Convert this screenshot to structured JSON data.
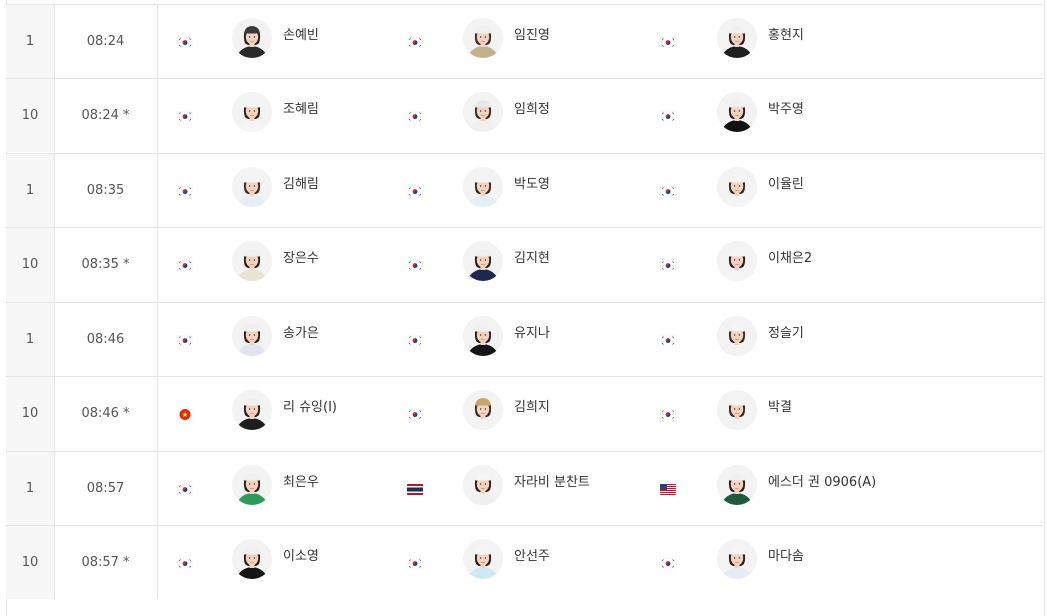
{
  "rows": [
    {
      "tee": "1",
      "time": "08:24",
      "players": [
        {
          "name": "손예빈",
          "flag": "kor",
          "jersey": "#2b2b2b",
          "hair": "#2a1f1a",
          "cap": "#3a3a3a"
        },
        {
          "name": "임진영",
          "flag": "kor",
          "jersey": "#c2b18d",
          "hair": "#3a2a20",
          "cap": "#f0f0f0"
        },
        {
          "name": "홍현지",
          "flag": "kor",
          "jersey": "#1f1f1f",
          "hair": "#2a1f1a",
          "cap": "#f0f0f0"
        }
      ]
    },
    {
      "tee": "10",
      "time": "08:24 *",
      "players": [
        {
          "name": "조혜림",
          "flag": "kor",
          "jersey": "#f5f5f5",
          "hair": "#2a1f1a",
          "cap": "#f5f5f5"
        },
        {
          "name": "임희정",
          "flag": "kor",
          "jersey": "#f0f0f0",
          "hair": "#3a2a20",
          "cap": "#e8e8e8"
        },
        {
          "name": "박주영",
          "flag": "kor",
          "jersey": "#111111",
          "hair": "#2a1f1a",
          "cap": "#f0f0f0"
        }
      ]
    },
    {
      "tee": "1",
      "time": "08:35",
      "players": [
        {
          "name": "김해림",
          "flag": "kor",
          "jersey": "#e8eef6",
          "hair": "#3a2a20",
          "cap": "#f5f5f5"
        },
        {
          "name": "박도영",
          "flag": "kor",
          "jersey": "#e6edf5",
          "hair": "#3a2a20",
          "cap": "#f5f5f5"
        },
        {
          "name": "이율린",
          "flag": "kor",
          "jersey": "#f5f5f5",
          "hair": "#3a2a20",
          "cap": "#f5f5f5"
        }
      ]
    },
    {
      "tee": "10",
      "time": "08:35 *",
      "players": [
        {
          "name": "장은수",
          "flag": "kor",
          "jersey": "#e9e3d3",
          "hair": "#2a1f1a",
          "cap": "#f0f0f0"
        },
        {
          "name": "김지현",
          "flag": "kor",
          "jersey": "#1e2750",
          "hair": "#2a1f1a",
          "cap": "#f0f0f0"
        },
        {
          "name": "이채은2",
          "flag": "kor",
          "jersey": "#f5f5f5",
          "hair": "#2a1f1a",
          "cap": "#f5f5f5"
        }
      ]
    },
    {
      "tee": "1",
      "time": "08:46",
      "players": [
        {
          "name": "송가은",
          "flag": "kor",
          "jersey": "#dfe6ef",
          "hair": "#2a1f1a",
          "cap": "#f0f0f0"
        },
        {
          "name": "유지나",
          "flag": "kor",
          "jersey": "#141414",
          "hair": "#2a1f1a",
          "cap": "#f0f0f0"
        },
        {
          "name": "정슬기",
          "flag": "kor",
          "jersey": "#f3f3f3",
          "hair": "#3a2a20",
          "cap": "#f5f5f5"
        }
      ]
    },
    {
      "tee": "10",
      "time": "08:46 *",
      "players": [
        {
          "name": "리 슈잉(I)",
          "flag": "chn",
          "jersey": "#1d1d1d",
          "hair": "#2a1f1a",
          "cap": "#f0f0f0"
        },
        {
          "name": "김희지",
          "flag": "kor",
          "jersey": "#f3f3f3",
          "hair": "#3a2a20",
          "cap": "#c9a56b"
        },
        {
          "name": "박결",
          "flag": "kor",
          "jersey": "#f2f2f2",
          "hair": "#3a2a20",
          "cap": "#f5f5f5"
        }
      ]
    },
    {
      "tee": "1",
      "time": "08:57",
      "players": [
        {
          "name": "최은우",
          "flag": "kor",
          "jersey": "#2e9a55",
          "hair": "#2a1f1a",
          "cap": "#f0f0f0"
        },
        {
          "name": "자라비 분찬트",
          "flag": "tha",
          "jersey": "#f0f0f0",
          "hair": "#2a1f1a",
          "cap": "#f5f5f5"
        },
        {
          "name": "에스더 권 0906(A)",
          "flag": "usa",
          "jersey": "#1f5a3a",
          "hair": "#2a1f1a",
          "cap": "#f0f0f0"
        }
      ]
    },
    {
      "tee": "10",
      "time": "08:57 *",
      "players": [
        {
          "name": "이소영",
          "flag": "kor",
          "jersey": "#151515",
          "hair": "#2a1f1a",
          "cap": "#f0f0f0"
        },
        {
          "name": "안선주",
          "flag": "kor",
          "jersey": "#cfe9f2",
          "hair": "#2a1f1a",
          "cap": "#f5f5f5"
        },
        {
          "name": "마다솜",
          "flag": "kor",
          "jersey": "#e6ecf4",
          "hair": "#2a1f1a",
          "cap": "#f5f5f5"
        }
      ]
    }
  ],
  "colors": {
    "border": "#e5e5e5",
    "tee_bg": "#f7f7f7",
    "text": "#333333",
    "muted": "#555555"
  }
}
